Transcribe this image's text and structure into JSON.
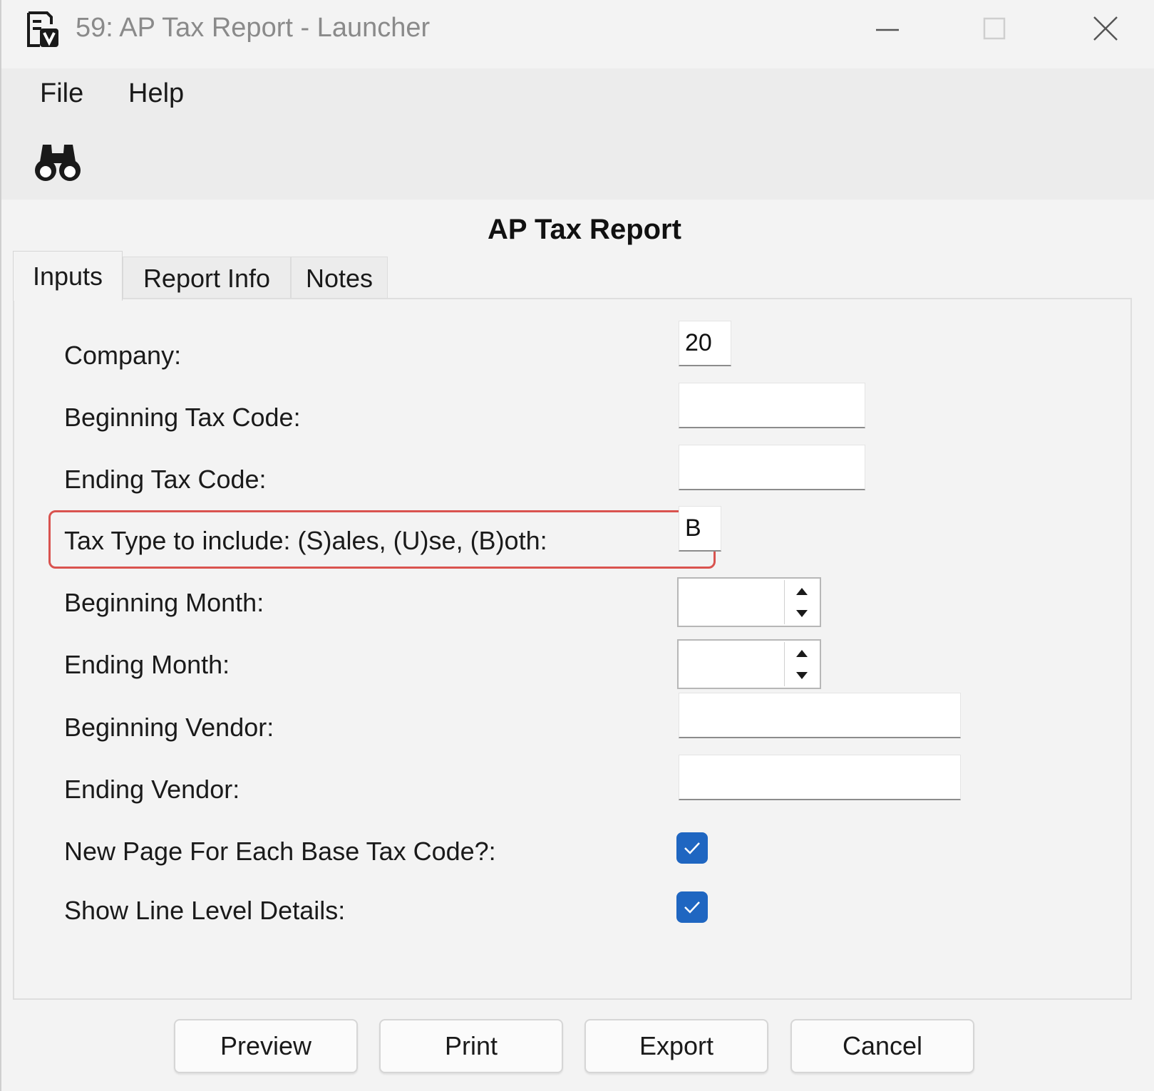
{
  "window": {
    "title": "59: AP Tax Report - Launcher",
    "controls": {
      "minimize": "minimize",
      "maximize": "maximize",
      "close": "close"
    }
  },
  "menu": {
    "file": "File",
    "help": "Help"
  },
  "toolbar": {
    "icons": [
      "binoculars-icon"
    ]
  },
  "report": {
    "title": "AP Tax Report"
  },
  "tabs": [
    {
      "label": "Inputs",
      "active": true
    },
    {
      "label": "Report Info",
      "active": false
    },
    {
      "label": "Notes",
      "active": false
    }
  ],
  "fields": {
    "company": {
      "label": "Company:",
      "value": "20"
    },
    "beginning_tax_code": {
      "label": "Beginning Tax Code:",
      "value": ""
    },
    "ending_tax_code": {
      "label": "Ending Tax Code:",
      "value": ""
    },
    "tax_type": {
      "label": "Tax Type to include: (S)ales, (U)se, (B)oth:",
      "value": "B"
    },
    "beginning_month": {
      "label": "Beginning Month:",
      "value": ""
    },
    "ending_month": {
      "label": "Ending Month:",
      "value": ""
    },
    "beginning_vendor": {
      "label": "Beginning Vendor:",
      "value": ""
    },
    "ending_vendor": {
      "label": "Ending Vendor:",
      "value": ""
    },
    "new_page_each_base_tax_code": {
      "label": "New Page For Each Base Tax Code?:",
      "checked": true
    },
    "show_line_level_details": {
      "label": "Show Line Level Details:",
      "checked": true
    }
  },
  "buttons": {
    "preview": "Preview",
    "print": "Print",
    "export": "Export",
    "cancel": "Cancel"
  },
  "colors": {
    "checkbox_accent": "#1f66c1",
    "highlight_border": "#d9534f",
    "window_bg": "#f3f3f3"
  }
}
